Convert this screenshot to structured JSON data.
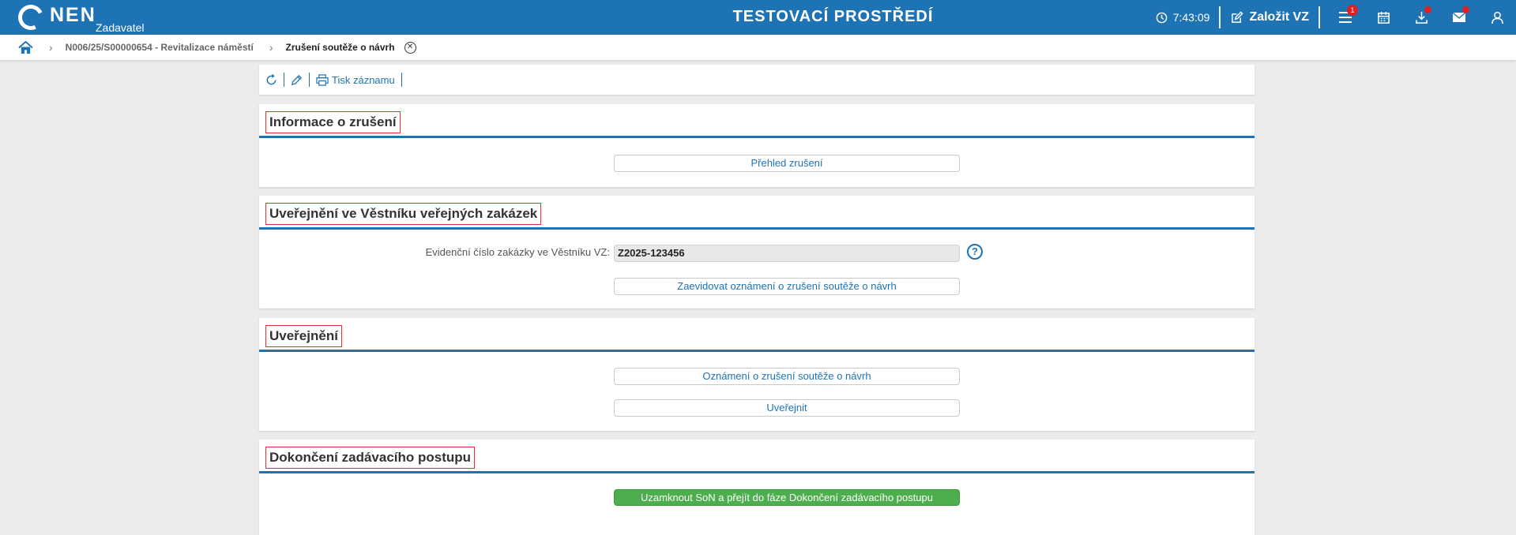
{
  "header": {
    "logo_text": "NEN",
    "logo_sub": "Zadavatel",
    "environment": "TESTOVACÍ PROSTŘEDÍ",
    "time": "7:43:09",
    "create_label": "Založit VZ",
    "menu_badge": "1",
    "icons": [
      "menu-icon",
      "calendar-icon",
      "download-icon",
      "mail-icon",
      "user-icon"
    ]
  },
  "breadcrumb": {
    "items": [
      {
        "label": "N006/25/S00000654 - Revitalizace náměstí"
      },
      {
        "label": "Zrušení soutěže o návrh"
      }
    ],
    "close_symbol": "✕"
  },
  "toolbar": {
    "print_label": "Tisk záznamu"
  },
  "sections": {
    "info": {
      "title": "Informace o zrušení",
      "button": "Přehled zrušení"
    },
    "vestnik": {
      "title": "Uveřejnění ve Věstníku veřejných zakázek",
      "field_label": "Evidenční číslo zakázky ve Věstníku VZ:",
      "field_value": "Z2025-123456",
      "help_symbol": "?",
      "button": "Zaevidovat oznámení o zrušení soutěže o návrh"
    },
    "publish": {
      "title": "Uveřejnění",
      "button1": "Oznámení o zrušení soutěže o návrh",
      "button2": "Uveřejnit"
    },
    "finish": {
      "title": "Dokončení zadávacího postupu",
      "button": "Uzamknout SoN a přejít do fáze Dokončení zadávacího postupu"
    }
  },
  "colors": {
    "brand": "#1e73b5",
    "success": "#4cae4c",
    "highlight_border": "#e03030"
  }
}
